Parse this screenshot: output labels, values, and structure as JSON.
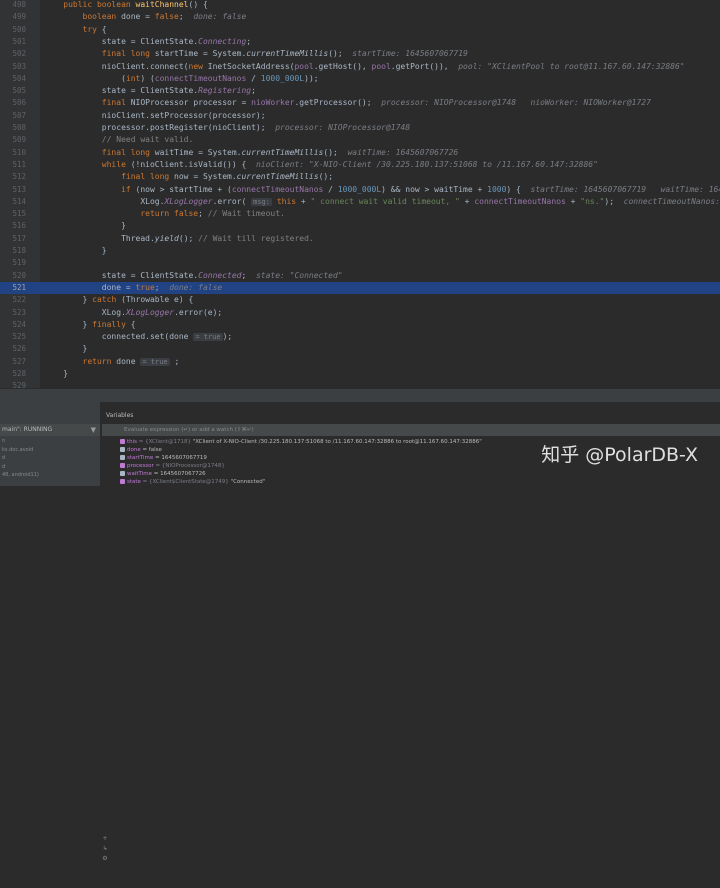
{
  "editor": {
    "lines": [
      {
        "n": "498",
        "html": "    <span class=\"kw\">public boolean </span><span class=\"fn\">waitChannel</span>() {"
      },
      {
        "n": "499",
        "html": "        <span class=\"kw\">boolean </span>done = <span class=\"kw\">false</span>;  <span class=\"hint\">done: false</span>"
      },
      {
        "n": "500",
        "html": "        <span class=\"kw\">try </span>{"
      },
      {
        "n": "501",
        "html": "            state = ClientState.<span class=\"st\">Connecting</span>;"
      },
      {
        "n": "502",
        "html": "            <span class=\"kw\">final long </span>startTime = System.<span class=\"it\">currentTimeMillis</span>();  <span class=\"hint\">startTime: 1645607067719</span>"
      },
      {
        "n": "503",
        "html": "            nioClient.connect(<span class=\"kw\">new </span>InetSocketAddress(<span class=\"stf\">pool</span>.getHost(), <span class=\"stf\">pool</span>.getPort()),  <span class=\"hint\">pool: \"XClientPool to root@11.167.60.147:32886\"</span>"
      },
      {
        "n": "504",
        "html": "                (<span class=\"kw\">int</span>) (<span class=\"stf\">connectTimeoutNanos</span> / <span class=\"num\">1000_000L</span>));"
      },
      {
        "n": "505",
        "html": "            state = ClientState.<span class=\"st\">Registering</span>;"
      },
      {
        "n": "506",
        "html": "            <span class=\"kw\">final </span>NIOProcessor processor = <span class=\"stf\">nioWorker</span>.getProcessor();  <span class=\"hint\">processor: NIOProcessor@1748   nioWorker: NIOWorker@1727</span>"
      },
      {
        "n": "507",
        "html": "            nioClient.setProcessor(processor);"
      },
      {
        "n": "508",
        "html": "            processor.postRegister(nioClient);  <span class=\"hint\">processor: NIOProcessor@1748</span>"
      },
      {
        "n": "509",
        "html": "            <span class=\"cm\">// Need wait valid.</span>"
      },
      {
        "n": "510",
        "html": "            <span class=\"kw\">final long </span>waitTime = System.<span class=\"it\">currentTimeMillis</span>();  <span class=\"hint\">waitTime: 1645607067726</span>"
      },
      {
        "n": "511",
        "html": "            <span class=\"kw\">while </span>(!nioClient.isValid()) {  <span class=\"hint\">nioClient: \"X-NIO-Client /30.225.180.137:51068 to /11.167.60.147:32886\"</span>"
      },
      {
        "n": "512",
        "html": "                <span class=\"kw\">final long </span>now = System.<span class=\"it\">currentTimeMillis</span>();"
      },
      {
        "n": "513",
        "html": "                <span class=\"kw\">if </span>(now > startTime + (<span class=\"stf\">connectTimeoutNanos</span> / <span class=\"num\">1000_000L</span>) && now > waitTime + <span class=\"num\">1000</span>) {  <span class=\"hint\">startTime: 1645607067719   waitTime: 1645607067726</span>"
      },
      {
        "n": "514",
        "html": "                    XLog.<span class=\"st\">XLogLogger</span>.error( <span class=\"tag\">msg:</span> <span class=\"kw\">this </span>+ <span class=\"str\">\" connect wait valid timeout, \"</span> + <span class=\"stf\">connectTimeoutNanos</span> + <span class=\"str\">\"ns.\"</span>);  <span class=\"hint\">connectTimeoutNanos: 2000000000</span>"
      },
      {
        "n": "515",
        "html": "                    <span class=\"kw\">return false</span>; <span class=\"cm\">// Wait timeout.</span>"
      },
      {
        "n": "516",
        "html": "                }"
      },
      {
        "n": "517",
        "html": "                Thread.<span class=\"it\">yield</span>(); <span class=\"cm\">// Wait till registered.</span>"
      },
      {
        "n": "518",
        "html": "            }"
      },
      {
        "n": "519",
        "html": ""
      },
      {
        "n": "520",
        "html": "            state = ClientState.<span class=\"st\">Connected</span>;  <span class=\"hint\">state: \"Connected\"</span>"
      },
      {
        "n": "521",
        "html": "            done = <span class=\"kw\">true</span>;  <span class=\"hint\">done: false</span>",
        "current": true
      },
      {
        "n": "522",
        "html": "        } <span class=\"kw\">catch </span>(Throwable e) {"
      },
      {
        "n": "523",
        "html": "            XLog.<span class=\"st\">XLogLogger</span>.error(e);"
      },
      {
        "n": "524",
        "html": "        } <span class=\"kw\">finally </span>{"
      },
      {
        "n": "525",
        "html": "            connected.set(done <span class=\"tag\">= true</span>);"
      },
      {
        "n": "526",
        "html": "        }"
      },
      {
        "n": "527",
        "html": "        <span class=\"kw\">return </span>done <span class=\"tag\">= true</span> ;"
      },
      {
        "n": "528",
        "html": "    }"
      },
      {
        "n": "529",
        "html": ""
      }
    ]
  },
  "debug": {
    "frames_header": "main\": RUNNING",
    "frames": [
      "n",
      "ks.doc.avoid",
      "d",
      "d",
      "48, android11)"
    ],
    "variables_title": "Variables",
    "eval_placeholder": "Evaluate expression (↵) or add a watch (⇧⌘↵)",
    "vars": [
      {
        "name": "this",
        "type": " = {XClient@1718}",
        "value": " \"XClient of X-NIO-Client /30.225.180.137:51068 to /11.167.60.147:32886 to root@11.167.60.147:32886\"",
        "color": "#c07bd6"
      },
      {
        "name": "done",
        "type": "",
        "value": " = false",
        "color": "#a9b7c6"
      },
      {
        "name": "startTime",
        "type": "",
        "value": " = 1645607067719",
        "color": "#a9b7c6"
      },
      {
        "name": "processor",
        "type": " = {NIOProcessor@1748}",
        "value": "",
        "color": "#c07bd6"
      },
      {
        "name": "waitTime",
        "type": "",
        "value": " = 1645607067726",
        "color": "#a9b7c6"
      },
      {
        "name": "state",
        "type": " = {XClient$ClientState@1749}",
        "value": " \"Connected\"",
        "color": "#c07bd6"
      }
    ]
  },
  "watermark": "知乎 @PolarDB-X",
  "colors": {
    "bg": "#2b2b2b",
    "current_line": "#214283",
    "keyword": "#cc7832",
    "static": "#9876aa"
  }
}
